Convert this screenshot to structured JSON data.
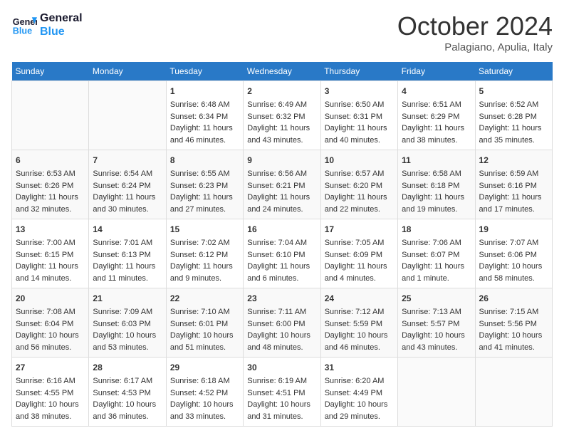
{
  "header": {
    "logo_line1": "General",
    "logo_line2": "Blue",
    "month_title": "October 2024",
    "location": "Palagiano, Apulia, Italy"
  },
  "days_of_week": [
    "Sunday",
    "Monday",
    "Tuesday",
    "Wednesday",
    "Thursday",
    "Friday",
    "Saturday"
  ],
  "weeks": [
    [
      {
        "day": "",
        "sunrise": "",
        "sunset": "",
        "daylight": ""
      },
      {
        "day": "",
        "sunrise": "",
        "sunset": "",
        "daylight": ""
      },
      {
        "day": "1",
        "sunrise": "Sunrise: 6:48 AM",
        "sunset": "Sunset: 6:34 PM",
        "daylight": "Daylight: 11 hours and 46 minutes."
      },
      {
        "day": "2",
        "sunrise": "Sunrise: 6:49 AM",
        "sunset": "Sunset: 6:32 PM",
        "daylight": "Daylight: 11 hours and 43 minutes."
      },
      {
        "day": "3",
        "sunrise": "Sunrise: 6:50 AM",
        "sunset": "Sunset: 6:31 PM",
        "daylight": "Daylight: 11 hours and 40 minutes."
      },
      {
        "day": "4",
        "sunrise": "Sunrise: 6:51 AM",
        "sunset": "Sunset: 6:29 PM",
        "daylight": "Daylight: 11 hours and 38 minutes."
      },
      {
        "day": "5",
        "sunrise": "Sunrise: 6:52 AM",
        "sunset": "Sunset: 6:28 PM",
        "daylight": "Daylight: 11 hours and 35 minutes."
      }
    ],
    [
      {
        "day": "6",
        "sunrise": "Sunrise: 6:53 AM",
        "sunset": "Sunset: 6:26 PM",
        "daylight": "Daylight: 11 hours and 32 minutes."
      },
      {
        "day": "7",
        "sunrise": "Sunrise: 6:54 AM",
        "sunset": "Sunset: 6:24 PM",
        "daylight": "Daylight: 11 hours and 30 minutes."
      },
      {
        "day": "8",
        "sunrise": "Sunrise: 6:55 AM",
        "sunset": "Sunset: 6:23 PM",
        "daylight": "Daylight: 11 hours and 27 minutes."
      },
      {
        "day": "9",
        "sunrise": "Sunrise: 6:56 AM",
        "sunset": "Sunset: 6:21 PM",
        "daylight": "Daylight: 11 hours and 24 minutes."
      },
      {
        "day": "10",
        "sunrise": "Sunrise: 6:57 AM",
        "sunset": "Sunset: 6:20 PM",
        "daylight": "Daylight: 11 hours and 22 minutes."
      },
      {
        "day": "11",
        "sunrise": "Sunrise: 6:58 AM",
        "sunset": "Sunset: 6:18 PM",
        "daylight": "Daylight: 11 hours and 19 minutes."
      },
      {
        "day": "12",
        "sunrise": "Sunrise: 6:59 AM",
        "sunset": "Sunset: 6:16 PM",
        "daylight": "Daylight: 11 hours and 17 minutes."
      }
    ],
    [
      {
        "day": "13",
        "sunrise": "Sunrise: 7:00 AM",
        "sunset": "Sunset: 6:15 PM",
        "daylight": "Daylight: 11 hours and 14 minutes."
      },
      {
        "day": "14",
        "sunrise": "Sunrise: 7:01 AM",
        "sunset": "Sunset: 6:13 PM",
        "daylight": "Daylight: 11 hours and 11 minutes."
      },
      {
        "day": "15",
        "sunrise": "Sunrise: 7:02 AM",
        "sunset": "Sunset: 6:12 PM",
        "daylight": "Daylight: 11 hours and 9 minutes."
      },
      {
        "day": "16",
        "sunrise": "Sunrise: 7:04 AM",
        "sunset": "Sunset: 6:10 PM",
        "daylight": "Daylight: 11 hours and 6 minutes."
      },
      {
        "day": "17",
        "sunrise": "Sunrise: 7:05 AM",
        "sunset": "Sunset: 6:09 PM",
        "daylight": "Daylight: 11 hours and 4 minutes."
      },
      {
        "day": "18",
        "sunrise": "Sunrise: 7:06 AM",
        "sunset": "Sunset: 6:07 PM",
        "daylight": "Daylight: 11 hours and 1 minute."
      },
      {
        "day": "19",
        "sunrise": "Sunrise: 7:07 AM",
        "sunset": "Sunset: 6:06 PM",
        "daylight": "Daylight: 10 hours and 58 minutes."
      }
    ],
    [
      {
        "day": "20",
        "sunrise": "Sunrise: 7:08 AM",
        "sunset": "Sunset: 6:04 PM",
        "daylight": "Daylight: 10 hours and 56 minutes."
      },
      {
        "day": "21",
        "sunrise": "Sunrise: 7:09 AM",
        "sunset": "Sunset: 6:03 PM",
        "daylight": "Daylight: 10 hours and 53 minutes."
      },
      {
        "day": "22",
        "sunrise": "Sunrise: 7:10 AM",
        "sunset": "Sunset: 6:01 PM",
        "daylight": "Daylight: 10 hours and 51 minutes."
      },
      {
        "day": "23",
        "sunrise": "Sunrise: 7:11 AM",
        "sunset": "Sunset: 6:00 PM",
        "daylight": "Daylight: 10 hours and 48 minutes."
      },
      {
        "day": "24",
        "sunrise": "Sunrise: 7:12 AM",
        "sunset": "Sunset: 5:59 PM",
        "daylight": "Daylight: 10 hours and 46 minutes."
      },
      {
        "day": "25",
        "sunrise": "Sunrise: 7:13 AM",
        "sunset": "Sunset: 5:57 PM",
        "daylight": "Daylight: 10 hours and 43 minutes."
      },
      {
        "day": "26",
        "sunrise": "Sunrise: 7:15 AM",
        "sunset": "Sunset: 5:56 PM",
        "daylight": "Daylight: 10 hours and 41 minutes."
      }
    ],
    [
      {
        "day": "27",
        "sunrise": "Sunrise: 6:16 AM",
        "sunset": "Sunset: 4:55 PM",
        "daylight": "Daylight: 10 hours and 38 minutes."
      },
      {
        "day": "28",
        "sunrise": "Sunrise: 6:17 AM",
        "sunset": "Sunset: 4:53 PM",
        "daylight": "Daylight: 10 hours and 36 minutes."
      },
      {
        "day": "29",
        "sunrise": "Sunrise: 6:18 AM",
        "sunset": "Sunset: 4:52 PM",
        "daylight": "Daylight: 10 hours and 33 minutes."
      },
      {
        "day": "30",
        "sunrise": "Sunrise: 6:19 AM",
        "sunset": "Sunset: 4:51 PM",
        "daylight": "Daylight: 10 hours and 31 minutes."
      },
      {
        "day": "31",
        "sunrise": "Sunrise: 6:20 AM",
        "sunset": "Sunset: 4:49 PM",
        "daylight": "Daylight: 10 hours and 29 minutes."
      },
      {
        "day": "",
        "sunrise": "",
        "sunset": "",
        "daylight": ""
      },
      {
        "day": "",
        "sunrise": "",
        "sunset": "",
        "daylight": ""
      }
    ]
  ]
}
